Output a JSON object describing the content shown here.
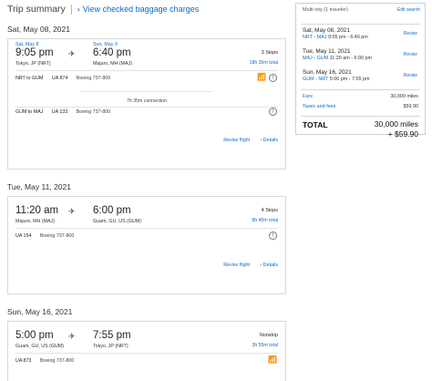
{
  "header": {
    "title": "Trip summary",
    "baggage_link": "View checked baggage charges"
  },
  "days": [
    {
      "heading": "Sat, May 08, 2021",
      "dep_date": "Sat, May 8",
      "dep_time": "9:05 pm",
      "dep_city": "Tokyo, JP (NRT)",
      "arr_date": "Sun, May 9",
      "arr_time": "6:40 pm",
      "arr_city": "Majuro, MH (MAJ)",
      "stops": "3 Stops",
      "duration": "18h 35m total",
      "segments": [
        {
          "route": "NRT to GUM",
          "flight": "UA 874",
          "aircraft": "Boeing 737-800"
        },
        {
          "route": "GUM to MAJ",
          "flight": "UA 133",
          "aircraft": "Boeing 737-800"
        }
      ],
      "connection": "7h 35m connection",
      "revise": "Revise flight",
      "details": "Details"
    },
    {
      "heading": "Tue, May 11, 2021",
      "dep_time": "11:20 am",
      "dep_city": "Majuro, MH (MAJ)",
      "arr_time": "6:00 pm",
      "arr_city": "Guam, GU, US (GUM)",
      "stops": "4 Stops",
      "duration": "8h 40m total",
      "segments": [
        {
          "route": "",
          "flight": "UA 154",
          "aircraft": "Boeing 737-800"
        }
      ],
      "revise": "Revise flight",
      "details": "Details"
    },
    {
      "heading": "Sun, May 16, 2021",
      "dep_time": "5:00 pm",
      "dep_city": "Guam, GU, US (GUM)",
      "arr_time": "7:55 pm",
      "arr_city": "Tokyo, JP (NRT)",
      "stops": "Nonstop",
      "duration": "3h 55m total",
      "segments": [
        {
          "route": "",
          "flight": "UA 873",
          "aircraft": "Boeing 737-800"
        }
      ]
    }
  ],
  "panel": {
    "trip_type": "Multi-city (1 traveler)",
    "edit_search": "Edit search",
    "legs": [
      {
        "date": "Sat, May 08, 2021",
        "codes": "NRT - MAJ",
        "times": "9:05 pm - 6:40 pm",
        "revise": "Revise"
      },
      {
        "date": "Tue, May 11, 2021",
        "codes": "MAJ - GUM",
        "times": "11:20 am - 6:00 pm",
        "revise": "Revise"
      },
      {
        "date": "Sun, May 16, 2021",
        "codes": "GUM - NRT",
        "times": "5:00 pm - 7:55 pm",
        "revise": "Revise"
      }
    ],
    "fare_label": "Fare",
    "fare_value": "30,000 miles",
    "taxes_label": "Taxes and fees",
    "taxes_value": "$59.90",
    "total_label": "TOTAL",
    "total_miles": "30,000 miles",
    "total_cash": "+ $59.90"
  },
  "icons": {
    "plane": "airplane-icon",
    "info": "info-icon",
    "wifi": "wifi-icon",
    "chevron": "chevron-right-icon"
  },
  "colors": {
    "link": "#0c6bc7",
    "border": "#d8d8d8",
    "text": "#333333"
  }
}
